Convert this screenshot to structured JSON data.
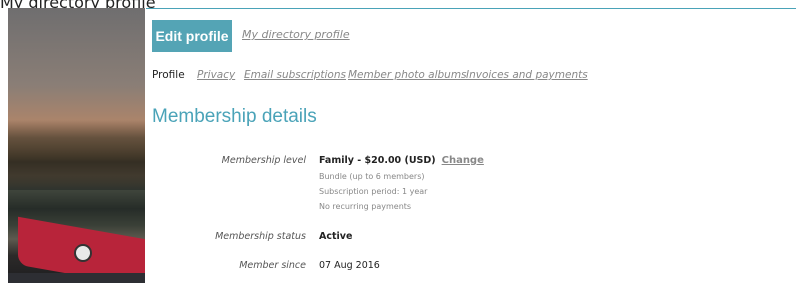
{
  "top_crop_text": "My directory profile",
  "header": {
    "edit_button": "Edit profile",
    "directory_link": "My directory profile"
  },
  "tabs": [
    {
      "label": "Profile",
      "active": true
    },
    {
      "label": "Privacy",
      "active": false
    },
    {
      "label": "Email subscriptions",
      "active": false
    },
    {
      "label": "Member photo albums",
      "active": false
    },
    {
      "label": "Invoices and payments",
      "active": false
    }
  ],
  "section": {
    "title": "Membership details",
    "level": {
      "label": "Membership level",
      "value": "Family - $20.00 (USD)",
      "change": "Change",
      "notes": [
        "Bundle (up to 6 members)",
        "Subscription period: 1 year",
        "No recurring payments"
      ]
    },
    "status": {
      "label": "Membership status",
      "value": "Active"
    },
    "since": {
      "label": "Member since",
      "value": "07 Aug 2016"
    }
  },
  "colors": {
    "accent": "#54a4b5",
    "heading": "#4aa3b8",
    "link": "#888888"
  }
}
